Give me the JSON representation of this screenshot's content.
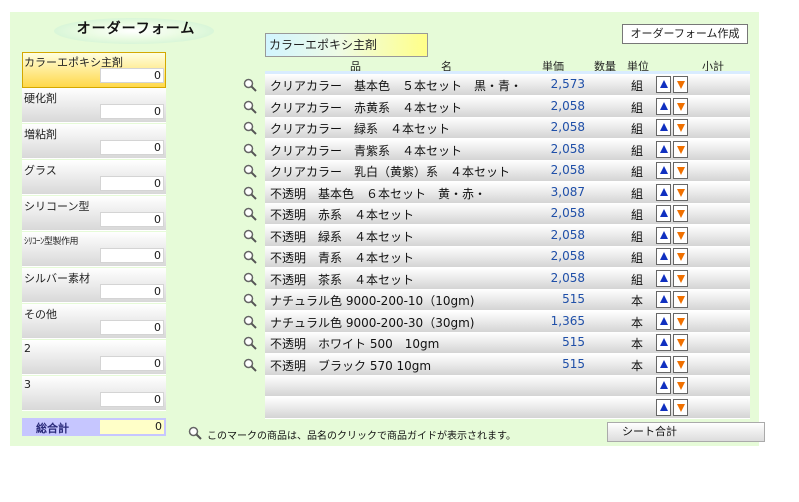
{
  "title": "オーダーフォーム",
  "order_button": "オーダーフォーム作成",
  "section_header": "カラーエポキシ主剤",
  "columns": {
    "name1": "品",
    "name2": "名",
    "price": "単価",
    "qty": "数量",
    "unit": "単位",
    "subtotal": "小計"
  },
  "categories": [
    {
      "label": "カラーエポキシ主剤",
      "value": "0"
    },
    {
      "label": "硬化剤",
      "value": "0"
    },
    {
      "label": "増粘剤",
      "value": "0"
    },
    {
      "label": "グラス",
      "value": "0"
    },
    {
      "label": "シリコーン型",
      "value": "0"
    },
    {
      "label": "ｼﾘｺｰﾝ型製作用",
      "value": "0"
    },
    {
      "label": "シルバー素材",
      "value": "0"
    },
    {
      "label": "その他",
      "value": "0"
    },
    {
      "label": "2",
      "value": "0"
    },
    {
      "label": "3",
      "value": "0"
    }
  ],
  "grand_total": {
    "label": "総合計",
    "value": "0"
  },
  "rows": [
    {
      "name": "クリアカラー　基本色　５本セット　黒・青・",
      "price": "2,573",
      "unit": "組"
    },
    {
      "name": "クリアカラー　赤黄系　４本セット",
      "price": "2,058",
      "unit": "組"
    },
    {
      "name": "クリアカラー　緑系　４本セット",
      "price": "2,058",
      "unit": "組"
    },
    {
      "name": "クリアカラー　青紫系　４本セット",
      "price": "2,058",
      "unit": "組"
    },
    {
      "name": "クリアカラー　乳白（黄紫）系　４本セット",
      "price": "2,058",
      "unit": "組"
    },
    {
      "name": "不透明　基本色　６本セット　黄・赤・",
      "price": "3,087",
      "unit": "組"
    },
    {
      "name": "不透明　赤系　４本セット",
      "price": "2,058",
      "unit": "組"
    },
    {
      "name": "不透明　緑系　４本セット",
      "price": "2,058",
      "unit": "組"
    },
    {
      "name": "不透明　青系　４本セット",
      "price": "2,058",
      "unit": "組"
    },
    {
      "name": "不透明　茶系　４本セット",
      "price": "2,058",
      "unit": "組"
    },
    {
      "name": "ナチュラル色 9000-200-10（10gm)",
      "price": "515",
      "unit": "本"
    },
    {
      "name": "ナチュラル色 9000-200-30（30gm)",
      "price": "1,365",
      "unit": "本"
    },
    {
      "name": "不透明　ホワイト 500　10gm",
      "price": "515",
      "unit": "本"
    },
    {
      "name": "不透明　ブラック 570 10gm",
      "price": "515",
      "unit": "本"
    },
    {
      "name": "",
      "price": "",
      "unit": ""
    },
    {
      "name": "",
      "price": "",
      "unit": ""
    }
  ],
  "footer_note": "このマークの商品は、品名のクリックで商品ガイドが表示されます。",
  "sheet_total": "シート合計"
}
